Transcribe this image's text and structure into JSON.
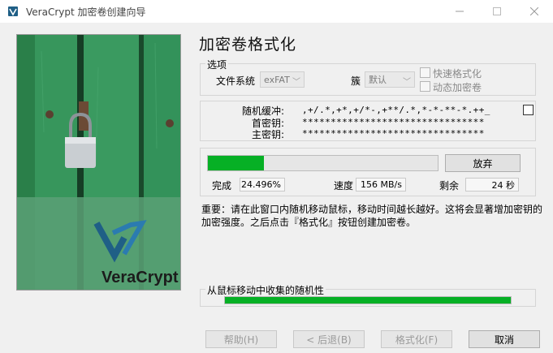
{
  "window": {
    "title": "VeraCrypt 加密卷创建向导"
  },
  "page": {
    "title": "加密卷格式化"
  },
  "side_image": {
    "brand": "VeraCrypt"
  },
  "options": {
    "caption": "选项",
    "filesystem_label": "文件系统",
    "filesystem_value": "exFAT",
    "cluster_label": "簇",
    "cluster_value": "默认",
    "quick_format_label": "快速格式化",
    "dynamic_label": "动态加密卷",
    "quick_format_checked": false,
    "dynamic_checked": false
  },
  "keys": {
    "random_pool_label": "随机缓冲:",
    "random_pool_value": ",+/.*,+*,+/*-,+**/.*,*-*-**-*.++_",
    "header_key_label": "首密钥:",
    "header_key_value": "********************************",
    "master_key_label": "主密钥:",
    "master_key_value": "********************************",
    "show_checked": false
  },
  "progress": {
    "percent": 24.496,
    "abort_label": "放弃",
    "done_label": "完成",
    "done_value": "24.496%",
    "speed_label": "速度",
    "speed_value": "156 MB/s",
    "remaining_label": "剩余",
    "remaining_value": "24 秒"
  },
  "notice": {
    "text": "重要：请在此窗口内随机移动鼠标，移动时间越长越好。这将会显著增加密钥的加密强度。之后点击『格式化』按钮创建加密卷。"
  },
  "randomness": {
    "caption": "从鼠标移动中收集的随机性",
    "percent": 100
  },
  "footer": {
    "help_label": "帮助(H)",
    "back_label": "< 后退(B)",
    "format_label": "格式化(F)",
    "cancel_label": "取消"
  },
  "colors": {
    "progress_green": "#06b025",
    "plank_green": "#2c8a50",
    "logo_blue": "#1f5f86"
  }
}
